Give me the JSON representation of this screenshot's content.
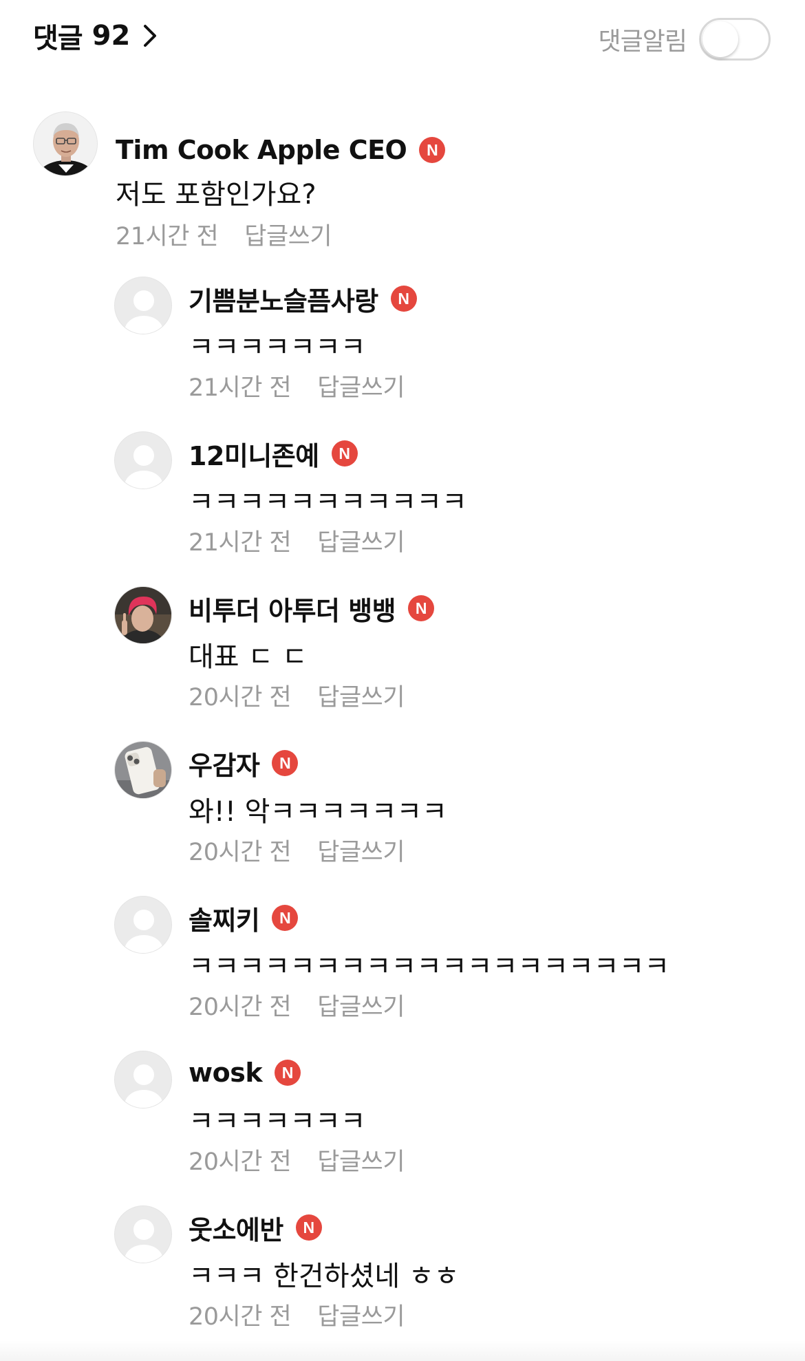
{
  "header": {
    "title": "댓글",
    "count": "92",
    "notify_label": "댓글알림",
    "notify_enabled": false
  },
  "badge_letter": "N",
  "comments": [
    {
      "author": "Tim Cook Apple CEO",
      "text": "저도 포함인가요?",
      "time": "21시간 전",
      "reply_label": "답글쓰기",
      "avatar": "photo-man-glasses"
    },
    {
      "author": "기쁨분노슬픔사랑",
      "text": "ㅋㅋㅋㅋㅋㅋㅋ",
      "time": "21시간 전",
      "reply_label": "답글쓰기",
      "avatar": "default-person-icon"
    },
    {
      "author": "12미니존예",
      "text": "ㅋㅋㅋㅋㅋㅋㅋㅋㅋㅋㅋ",
      "time": "21시간 전",
      "reply_label": "답글쓰기",
      "avatar": "default-person-icon"
    },
    {
      "author": "비투더 아투더 뱅뱅",
      "text": "대표 ㄷ ㄷ",
      "time": "20시간 전",
      "reply_label": "답글쓰기",
      "avatar": "photo-red-hair-person"
    },
    {
      "author": "우감자",
      "text": "와!! 악ㅋㅋㅋㅋㅋㅋㅋ",
      "time": "20시간 전",
      "reply_label": "답글쓰기",
      "avatar": "photo-white-phone"
    },
    {
      "author": "솔찌키",
      "text": "ㅋㅋㅋㅋㅋㅋㅋㅋㅋㅋㅋㅋㅋㅋㅋㅋㅋㅋㅋ",
      "time": "20시간 전",
      "reply_label": "답글쓰기",
      "avatar": "default-person-icon"
    },
    {
      "author": "wosk",
      "text": "ㅋㅋㅋㅋㅋㅋㅋ",
      "time": "20시간 전",
      "reply_label": "답글쓰기",
      "avatar": "default-person-icon"
    },
    {
      "author": "웃소에반",
      "text": "ㅋㅋㅋ 한건하셨네 ㅎㅎ",
      "time": "20시간 전",
      "reply_label": "답글쓰기",
      "avatar": "default-person-icon"
    }
  ]
}
